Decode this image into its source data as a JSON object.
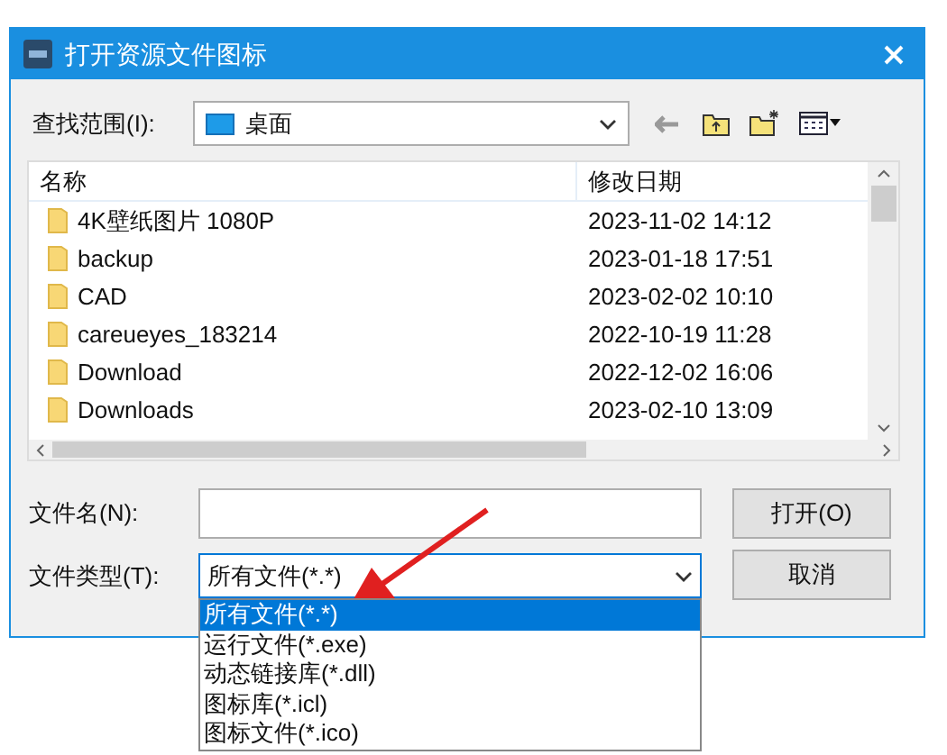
{
  "window": {
    "title": "打开资源文件图标"
  },
  "look_in": {
    "label": "查找范围(I):",
    "value": "桌面"
  },
  "file_list": {
    "columns": [
      "名称",
      "修改日期"
    ],
    "rows": [
      {
        "name": "4K壁纸图片 1080P",
        "modified": "2023-11-02 14:12"
      },
      {
        "name": "backup",
        "modified": "2023-01-18 17:51"
      },
      {
        "name": "CAD",
        "modified": "2023-02-02 10:10"
      },
      {
        "name": "careueyes_183214",
        "modified": "2022-10-19 11:28"
      },
      {
        "name": "Download",
        "modified": "2022-12-02 16:06"
      },
      {
        "name": "Downloads",
        "modified": "2023-02-10 13:09"
      }
    ]
  },
  "file_name": {
    "label": "文件名(N):"
  },
  "file_type": {
    "label": "文件类型(T):",
    "value": "所有文件(*.*)",
    "expanded": true,
    "options": [
      {
        "label": "所有文件(*.*)",
        "selected": true
      },
      {
        "label": "运行文件(*.exe)",
        "selected": false
      },
      {
        "label": "动态链接库(*.dll)",
        "selected": false
      },
      {
        "label": "图标库(*.icl)",
        "selected": false
      },
      {
        "label": "图标文件(*.ico)",
        "selected": false
      }
    ]
  },
  "buttons": [
    "打开(O)",
    "取消"
  ]
}
